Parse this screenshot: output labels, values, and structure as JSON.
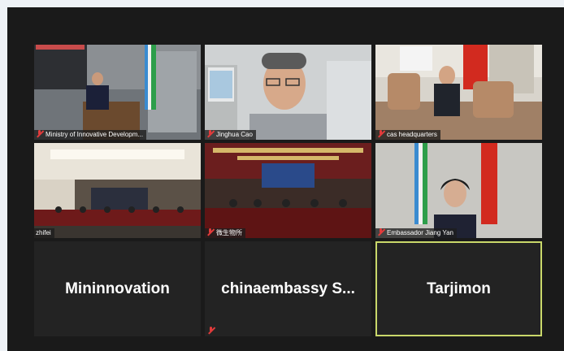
{
  "tiles": [
    {
      "name": "Ministry of Innovative Developm...",
      "muted": true
    },
    {
      "name": "Jinghua Cao",
      "muted": true
    },
    {
      "name": "cas headquarters",
      "muted": true
    },
    {
      "name": "zhifei",
      "muted": false
    },
    {
      "name": "微生物所",
      "muted": true
    },
    {
      "name": "Embassador Jiang Yan",
      "muted": true
    }
  ],
  "name_tiles": [
    {
      "name": "Mininnovation"
    },
    {
      "name": "chinaembassy  S..."
    },
    {
      "name": "Tarjimon"
    }
  ],
  "colors": {
    "active_speaker": "#c9d86a",
    "muted_icon": "#e23b3b",
    "background": "#1a1a1a"
  },
  "icons": {
    "muted": "microphone-muted-icon"
  }
}
